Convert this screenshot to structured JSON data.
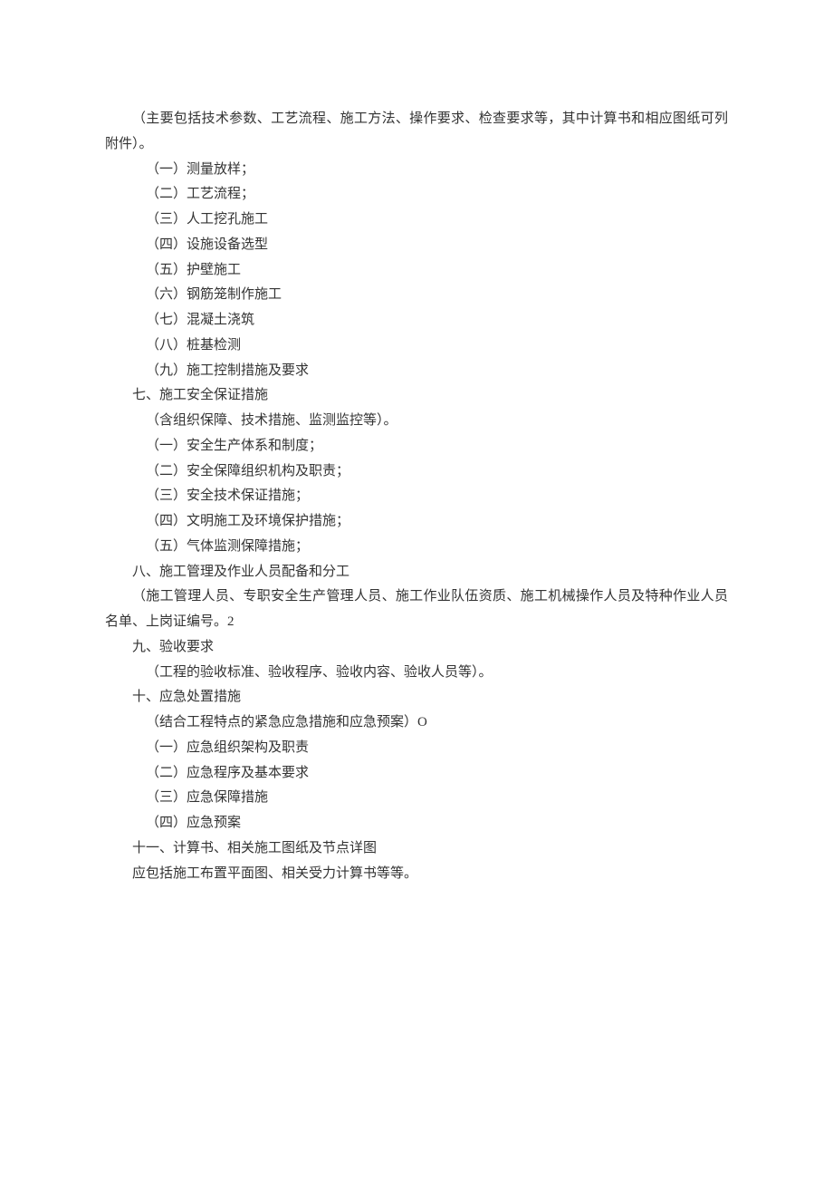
{
  "lines": [
    {
      "text": "（主要包括技术参数、工艺流程、施工方法、操作要求、检查要求等，其中计算书和相应图纸可列附件）。",
      "cls": "hanging"
    },
    {
      "text": "（一）测量放样；",
      "cls": "indent2"
    },
    {
      "text": "（二）工艺流程；",
      "cls": "indent2"
    },
    {
      "text": "（三）人工挖孔施工",
      "cls": "indent2"
    },
    {
      "text": "（四）设施设备选型",
      "cls": "indent2"
    },
    {
      "text": "（五）护壁施工",
      "cls": "indent2"
    },
    {
      "text": "（六）钢筋笼制作施工",
      "cls": "indent2"
    },
    {
      "text": "（七）混凝土浇筑",
      "cls": "indent2"
    },
    {
      "text": "（八）桩基检测",
      "cls": "indent2"
    },
    {
      "text": "（九）施工控制措施及要求",
      "cls": "indent2"
    },
    {
      "text": "七、施工安全保证措施",
      "cls": "indent1"
    },
    {
      "text": "（含组织保障、技术措施、监测监控等）。",
      "cls": "indent2"
    },
    {
      "text": "（一）安全生产体系和制度；",
      "cls": "indent2"
    },
    {
      "text": "（二）安全保障组织机构及职责；",
      "cls": "indent2"
    },
    {
      "text": "（三）安全技术保证措施；",
      "cls": "indent2"
    },
    {
      "text": "（四）文明施工及环境保护措施；",
      "cls": "indent2"
    },
    {
      "text": "（五）气体监测保障措施；",
      "cls": "indent2"
    },
    {
      "text": "八、施工管理及作业人员配备和分工",
      "cls": "indent1"
    },
    {
      "text": "（施工管理人员、专职安全生产管理人员、施工作业队伍资质、施工机械操作人员及特种作业人员名单、上岗证编号。2",
      "cls": "hanging"
    },
    {
      "text": "九、验收要求",
      "cls": "indent1"
    },
    {
      "text": "（工程的验收标准、验收程序、验收内容、验收人员等）。",
      "cls": "indent2"
    },
    {
      "text": "十、应急处置措施",
      "cls": "indent1"
    },
    {
      "text": "（结合工程特点的紧急应急措施和应急预案）O",
      "cls": "indent2"
    },
    {
      "text": "（一）应急组织架构及职责",
      "cls": "indent2"
    },
    {
      "text": "（二）应急程序及基本要求",
      "cls": "indent2"
    },
    {
      "text": "（三）应急保障措施",
      "cls": "indent2"
    },
    {
      "text": "（四）应急预案",
      "cls": "indent2"
    },
    {
      "text": "十一、计算书、相关施工图纸及节点详图",
      "cls": "indent1"
    },
    {
      "text": "应包括施工布置平面图、相关受力计算书等等。",
      "cls": "indent1"
    }
  ]
}
